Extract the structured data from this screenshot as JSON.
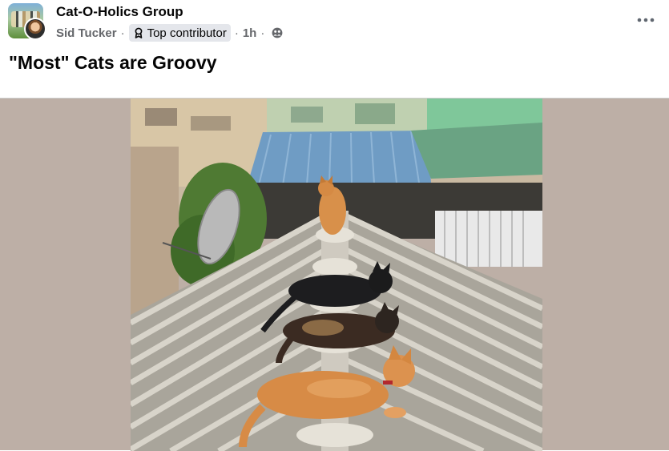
{
  "post": {
    "group_name": "Cat-O-Holics Group",
    "author": "Sid Tucker",
    "badge": "Top contributor",
    "time": "1h",
    "separator": "·",
    "title": "\"Most\" Cats are Groovy"
  },
  "icons": {
    "badge": "badge-icon",
    "privacy": "group-members-icon",
    "more": "more-options-icon"
  },
  "colors": {
    "media_background": "#bdafa6",
    "secondary_text": "#65676b",
    "badge_background": "#e4e6eb"
  }
}
